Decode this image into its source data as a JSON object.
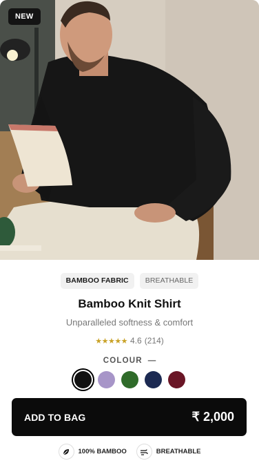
{
  "product": {
    "badge": "NEW",
    "tags": [
      "BAMBOO FABRIC",
      "BREATHABLE"
    ],
    "title": "Bamboo Knit Shirt",
    "subtitle": "Unparalleled softness & comfort",
    "rating": {
      "stars": "★★★★★",
      "value": "4.6",
      "count": "(214)"
    },
    "colour_label": "COLOUR",
    "colour_dash": "—",
    "swatches": [
      {
        "name": "black",
        "color": "#111111",
        "selected": true
      },
      {
        "name": "lavender",
        "color": "#a795c8"
      },
      {
        "name": "green",
        "color": "#2f6b2a"
      },
      {
        "name": "navy",
        "color": "#1c2a52"
      },
      {
        "name": "maroon",
        "color": "#6a1626"
      }
    ],
    "add_to_bag": "ADD TO BAG",
    "price": "₹ 2,000",
    "features": [
      {
        "icon": "leaf-icon",
        "label": "100% BAMBOO"
      },
      {
        "icon": "wind-icon",
        "label": "BREATHABLE"
      }
    ]
  }
}
